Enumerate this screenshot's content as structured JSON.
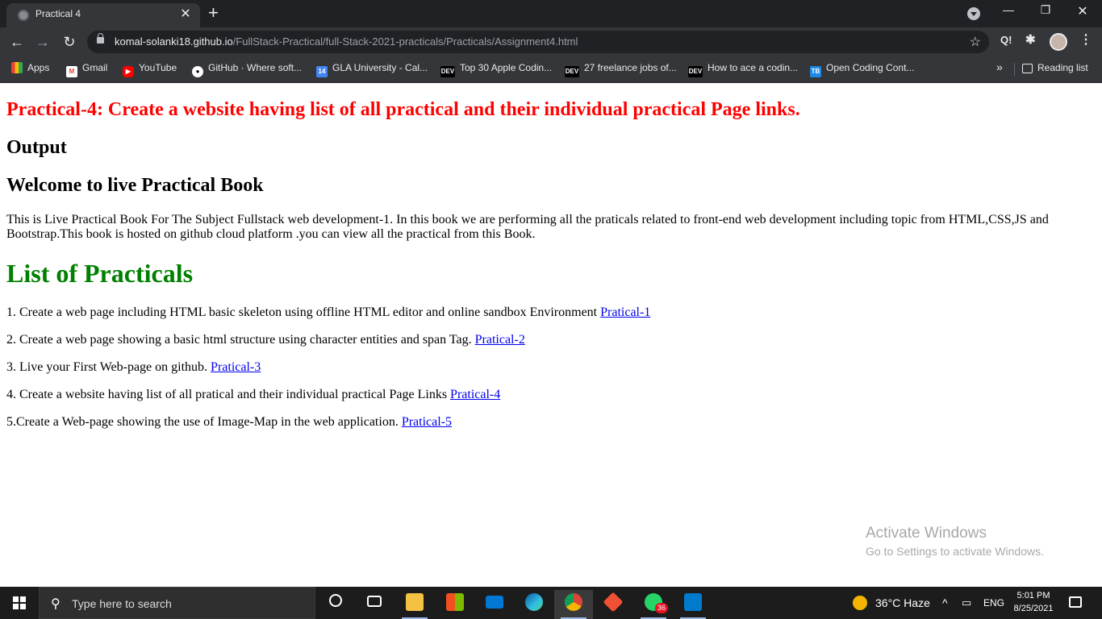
{
  "browser": {
    "tab_title": "Practical 4",
    "url_host": "komal-solanki18.github.io",
    "url_path": "/FullStack-Practical/full-Stack-2021-practicals/Practicals/Assignment4.html",
    "bookmarks": [
      {
        "label": "Apps",
        "icon": "apps-grid-icon"
      },
      {
        "label": "Gmail",
        "icon": "gmail-icon"
      },
      {
        "label": "YouTube",
        "icon": "youtube-icon"
      },
      {
        "label": "GitHub · Where soft...",
        "icon": "github-icon"
      },
      {
        "label": "GLA University - Cal...",
        "icon": "calendar-icon"
      },
      {
        "label": "Top 30 Apple Codin...",
        "icon": "dev-icon"
      },
      {
        "label": "27 freelance jobs of...",
        "icon": "dev-icon"
      },
      {
        "label": "How to ace a codin...",
        "icon": "dev-icon"
      },
      {
        "label": "Open Coding Cont...",
        "icon": "coding-contest-icon"
      }
    ],
    "overflow_label": "»",
    "reading_list": "Reading list"
  },
  "page": {
    "heading": "Practical-4: Create a website having list of all practical and their individual practical Page links.",
    "output": "Output",
    "welcome": "Welcome to live Practical Book",
    "intro": "This is Live Practical Book For The Subject Fullstack web development-1. In this book we are performing all the praticals related to front-end web development including topic from HTML,CSS,JS and Bootstrap.This book is hosted on github cloud platform .you can view all the practical from this Book.",
    "list_heading": "List of Practicals",
    "items": [
      {
        "text": "1. Create a web page including HTML basic skeleton using offline HTML editor and online sandbox Environment ",
        "link": "Pratical-1"
      },
      {
        "text": "2. Create a web page showing a basic html structure using character entities and span Tag. ",
        "link": "Pratical-2"
      },
      {
        "text": "3. Live your First Web-page on github. ",
        "link": "Pratical-3"
      },
      {
        "text": "4. Create a website having list of all pratical and their individual practical Page Links ",
        "link": "Pratical-4"
      },
      {
        "text": "5.Create a Web-page showing the use of Image-Map in the web application. ",
        "link": "Pratical-5"
      }
    ]
  },
  "watermark": {
    "title": "Activate Windows",
    "subtitle": "Go to Settings to activate Windows."
  },
  "taskbar": {
    "search_placeholder": "Type here to search",
    "whatsapp_badge": "36",
    "weather": "36°C  Haze",
    "language": "ENG",
    "time": "5:01 PM",
    "date": "8/25/2021"
  },
  "colors": {
    "heading_red": "#ff0000",
    "list_heading_green": "#008000",
    "link_blue": "#0000ee"
  }
}
